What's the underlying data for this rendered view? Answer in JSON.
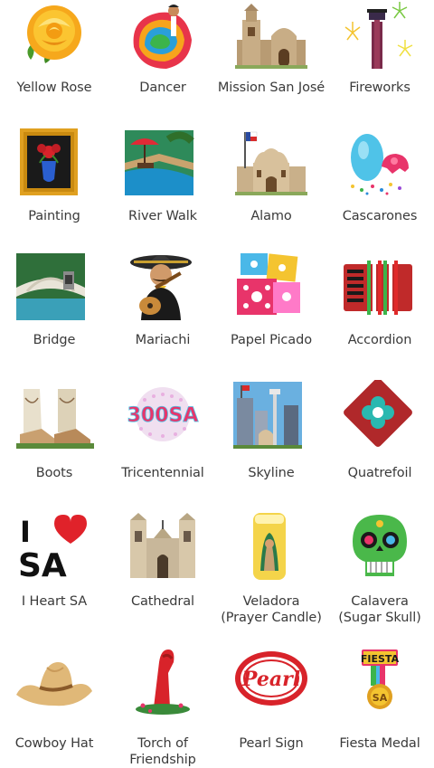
{
  "emoji_grid": [
    {
      "label": "Yellow Rose",
      "icon": "yellow-rose-icon"
    },
    {
      "label": "Dancer",
      "icon": "dancer-icon"
    },
    {
      "label": "Mission San José",
      "icon": "mission-san-jose-icon"
    },
    {
      "label": "Fireworks",
      "icon": "fireworks-icon"
    },
    {
      "label": "Painting",
      "icon": "painting-icon"
    },
    {
      "label": "River Walk",
      "icon": "river-walk-icon"
    },
    {
      "label": "Alamo",
      "icon": "alamo-icon"
    },
    {
      "label": "Cascarones",
      "icon": "cascarones-icon"
    },
    {
      "label": "Bridge",
      "icon": "bridge-icon"
    },
    {
      "label": "Mariachi",
      "icon": "mariachi-icon"
    },
    {
      "label": "Papel Picado",
      "icon": "papel-picado-icon"
    },
    {
      "label": "Accordion",
      "icon": "accordion-icon"
    },
    {
      "label": "Boots",
      "icon": "boots-icon"
    },
    {
      "label": "Tricentennial",
      "icon": "tricentennial-icon",
      "logo_text": "300SA"
    },
    {
      "label": "Skyline",
      "icon": "skyline-icon"
    },
    {
      "label": "Quatrefoil",
      "icon": "quatrefoil-icon"
    },
    {
      "label": "I Heart SA",
      "icon": "i-heart-sa-icon",
      "logo_text_top": "I",
      "logo_text_bottom": "SA"
    },
    {
      "label": "Cathedral",
      "icon": "cathedral-icon"
    },
    {
      "label": "Veladora",
      "label2": "(Prayer Candle)",
      "icon": "veladora-icon"
    },
    {
      "label": "Calavera",
      "label2": "(Sugar Skull)",
      "icon": "calavera-icon"
    },
    {
      "label": "Cowboy Hat",
      "icon": "cowboy-hat-icon"
    },
    {
      "label": "Torch of Friendship",
      "icon": "torch-of-friendship-icon"
    },
    {
      "label": "Pearl Sign",
      "icon": "pearl-sign-icon",
      "logo_text": "Pearl"
    },
    {
      "label": "Fiesta Medal",
      "icon": "fiesta-medal-icon",
      "logo_text": "FIESTA",
      "logo_text2": "SA"
    }
  ]
}
